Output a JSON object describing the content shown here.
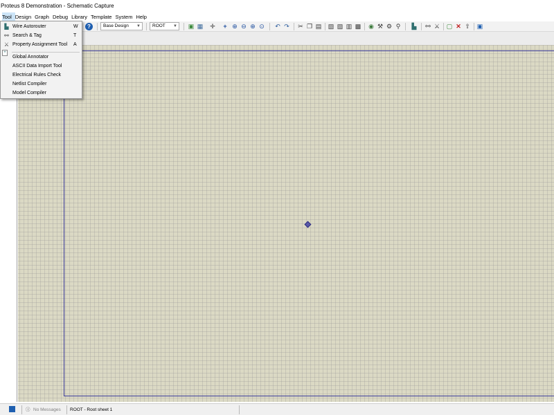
{
  "window": {
    "title": "Proteus 8 Demonstration - Schematic Capture"
  },
  "menubar": {
    "items": [
      "Tool",
      "Design",
      "Graph",
      "Debug",
      "Library",
      "Template",
      "System",
      "Help"
    ],
    "active_index": 0
  },
  "toolbar": {
    "variant_select": "Base Design",
    "sheet_select": "ROOT",
    "icons": [
      "help-icon",
      "grid-icon",
      "origin-icon",
      "pan-icon",
      "zoom-in-icon",
      "zoom-out-icon",
      "zoom-all-icon",
      "zoom-area-icon",
      "undo-icon",
      "redo-icon",
      "cut-icon",
      "copy-icon",
      "paste-icon",
      "block-copy-icon",
      "block-move-icon",
      "block-rotate-icon",
      "block-delete-icon",
      "pick-device-icon",
      "make-device-icon",
      "packaging-icon",
      "decompose-icon",
      "wire-autorouter-icon",
      "search-tag-icon",
      "property-assignment-icon",
      "new-sheet-icon",
      "delete-sheet-icon",
      "goto-sheet-icon",
      "export-icon"
    ]
  },
  "tool_menu": {
    "items": [
      {
        "label": "Wire Autorouter",
        "shortcut": "W",
        "icon": "wire-autorouter-icon"
      },
      {
        "label": "Search & Tag",
        "shortcut": "T",
        "icon": "search-tag-icon"
      },
      {
        "label": "Property Assignment Tool",
        "shortcut": "A",
        "icon": "property-assignment-icon"
      },
      {
        "label": "Global Annotator",
        "shortcut": "",
        "icon": ""
      },
      {
        "label": "ASCII Data Import Tool",
        "shortcut": "",
        "icon": ""
      },
      {
        "label": "Electrical Rules Check",
        "shortcut": "",
        "icon": ""
      },
      {
        "label": "Netlist Compiler",
        "shortcut": "",
        "icon": ""
      },
      {
        "label": "Model Compiler",
        "shortcut": "",
        "icon": ""
      }
    ]
  },
  "statusbar": {
    "messages": "No Messages",
    "sheet": "ROOT - Root sheet 1"
  },
  "colors": {
    "grid_background": "#dbd9c4",
    "sheet_border": "#3a3a99",
    "menu_highlight": "#cce4f7"
  }
}
